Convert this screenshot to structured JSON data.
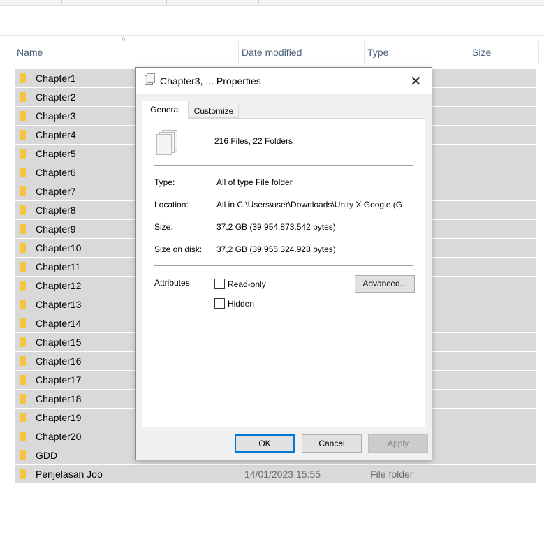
{
  "columns": {
    "name": "Name",
    "date": "Date modified",
    "type": "Type",
    "size": "Size"
  },
  "rows": [
    {
      "name": "Chapter1"
    },
    {
      "name": "Chapter2"
    },
    {
      "name": "Chapter3"
    },
    {
      "name": "Chapter4"
    },
    {
      "name": "Chapter5"
    },
    {
      "name": "Chapter6"
    },
    {
      "name": "Chapter7"
    },
    {
      "name": "Chapter8"
    },
    {
      "name": "Chapter9"
    },
    {
      "name": "Chapter10"
    },
    {
      "name": "Chapter11"
    },
    {
      "name": "Chapter12"
    },
    {
      "name": "Chapter13"
    },
    {
      "name": "Chapter14"
    },
    {
      "name": "Chapter15"
    },
    {
      "name": "Chapter16"
    },
    {
      "name": "Chapter17"
    },
    {
      "name": "Chapter18"
    },
    {
      "name": "Chapter19"
    },
    {
      "name": "Chapter20"
    },
    {
      "name": "GDD"
    },
    {
      "name": "Penjelasan Job",
      "date": "14/01/2023 15:55",
      "type": "File folder"
    }
  ],
  "dialog": {
    "title": "Chapter3, ... Properties",
    "tabs": [
      "General",
      "Customize"
    ],
    "summary": "216 Files, 22 Folders",
    "type_label": "Type:",
    "type_value": "All of type File folder",
    "location_label": "Location:",
    "location_value": "All in C:\\Users\\user\\Downloads\\Unity X Google (G",
    "size_label": "Size:",
    "size_value": "37,2 GB (39.954.873.542 bytes)",
    "disk_label": "Size on disk:",
    "disk_value": "37,2 GB (39.955.324.928 bytes)",
    "attributes_label": "Attributes",
    "readonly": "Read-only",
    "hidden": "Hidden",
    "advanced": "Advanced...",
    "ok": "OK",
    "cancel": "Cancel",
    "apply": "Apply"
  }
}
